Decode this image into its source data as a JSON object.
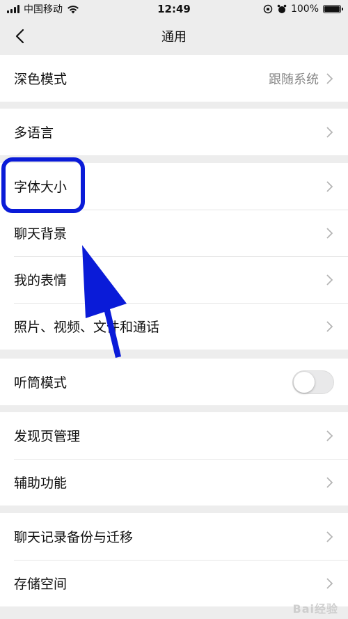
{
  "status_bar": {
    "carrier": "中国移动",
    "time": "12:49",
    "battery": "100%"
  },
  "header": {
    "title": "通用"
  },
  "groups": [
    {
      "items": [
        {
          "label": "深色模式",
          "value": "跟随系统"
        }
      ]
    },
    {
      "items": [
        {
          "label": "多语言"
        }
      ]
    },
    {
      "items": [
        {
          "label": "字体大小"
        },
        {
          "label": "聊天背景"
        },
        {
          "label": "我的表情"
        },
        {
          "label": "照片、视频、文件和通话"
        }
      ]
    },
    {
      "items": [
        {
          "label": "听筒模式",
          "toggle": false
        }
      ]
    },
    {
      "items": [
        {
          "label": "发现页管理"
        },
        {
          "label": "辅助功能"
        }
      ]
    },
    {
      "items": [
        {
          "label": "聊天记录备份与迁移"
        },
        {
          "label": "存储空间"
        }
      ]
    }
  ],
  "annotation": {
    "highlight_color": "#0a1bd8"
  },
  "watermark": "Bai经验"
}
